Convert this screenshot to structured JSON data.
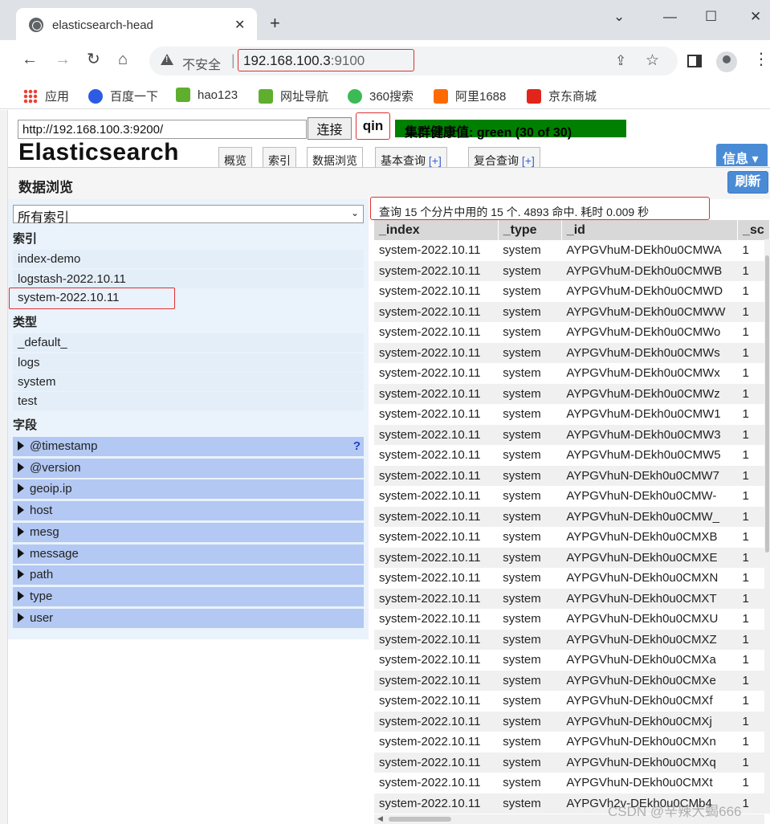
{
  "browser": {
    "tab_title": "elasticsearch-head",
    "new_tab": "+",
    "close_tab": "✕",
    "window_controls": {
      "minimize": "—",
      "maximize": "☐",
      "close": "✕",
      "tabsearch": "⌄"
    },
    "security_label": "不安全",
    "url_host": "192.168.100.3",
    "url_port": ":9100",
    "bookmarks": [
      {
        "label": "应用",
        "color": "#e94235"
      },
      {
        "label": "百度一下",
        "color": "#2d5be3"
      },
      {
        "label": "hao123",
        "color": "#5fae2e"
      },
      {
        "label": "网址导航",
        "color": "#5fae2e"
      },
      {
        "label": "360搜索",
        "color": "#3cba54"
      },
      {
        "label": "阿里1688",
        "color": "#ff6a00"
      },
      {
        "label": "京东商城",
        "color": "#e1251b"
      }
    ]
  },
  "head": {
    "connect_url": "http://192.168.100.3:9200/",
    "connect_label": "连接",
    "cluster_name": "qin",
    "cluster_health": "集群健康值: green (30 of 30)",
    "logo": "Elasticsearch",
    "tabs": [
      {
        "label": "概览",
        "plus": ""
      },
      {
        "label": "索引",
        "plus": ""
      },
      {
        "label": "数据浏览",
        "plus": ""
      },
      {
        "label": "基本查询 ",
        "plus": "[+]"
      },
      {
        "label": "复合查询 ",
        "plus": "[+]"
      }
    ],
    "info_label": "信息 ▾",
    "section_title": "数据浏览",
    "refresh_label": "刷新"
  },
  "filters": {
    "index_select": "所有索引",
    "index_heading": "索引",
    "indices": [
      "index-demo",
      "logstash-2022.10.11",
      "system-2022.10.11"
    ],
    "type_heading": "类型",
    "types": [
      "_default_",
      "logs",
      "system",
      "test"
    ],
    "field_heading": "字段",
    "fields": [
      "@timestamp",
      "@version",
      "geoip.ip",
      "host",
      "mesg",
      "message",
      "path",
      "type",
      "user"
    ],
    "help": "?"
  },
  "results": {
    "summary": "查询 15 个分片中用的 15 个. 4893 命中. 耗时 0.009 秒",
    "columns": [
      "_index",
      "_type",
      "_id",
      "_sc"
    ],
    "rows": [
      [
        "system-2022.10.11",
        "system",
        "AYPGVhuM-DEkh0u0CMWA",
        "1"
      ],
      [
        "system-2022.10.11",
        "system",
        "AYPGVhuM-DEkh0u0CMWB",
        "1"
      ],
      [
        "system-2022.10.11",
        "system",
        "AYPGVhuM-DEkh0u0CMWD",
        "1"
      ],
      [
        "system-2022.10.11",
        "system",
        "AYPGVhuM-DEkh0u0CMWW",
        "1"
      ],
      [
        "system-2022.10.11",
        "system",
        "AYPGVhuM-DEkh0u0CMWo",
        "1"
      ],
      [
        "system-2022.10.11",
        "system",
        "AYPGVhuM-DEkh0u0CMWs",
        "1"
      ],
      [
        "system-2022.10.11",
        "system",
        "AYPGVhuM-DEkh0u0CMWx",
        "1"
      ],
      [
        "system-2022.10.11",
        "system",
        "AYPGVhuM-DEkh0u0CMWz",
        "1"
      ],
      [
        "system-2022.10.11",
        "system",
        "AYPGVhuM-DEkh0u0CMW1",
        "1"
      ],
      [
        "system-2022.10.11",
        "system",
        "AYPGVhuM-DEkh0u0CMW3",
        "1"
      ],
      [
        "system-2022.10.11",
        "system",
        "AYPGVhuM-DEkh0u0CMW5",
        "1"
      ],
      [
        "system-2022.10.11",
        "system",
        "AYPGVhuN-DEkh0u0CMW7",
        "1"
      ],
      [
        "system-2022.10.11",
        "system",
        "AYPGVhuN-DEkh0u0CMW-",
        "1"
      ],
      [
        "system-2022.10.11",
        "system",
        "AYPGVhuN-DEkh0u0CMW_",
        "1"
      ],
      [
        "system-2022.10.11",
        "system",
        "AYPGVhuN-DEkh0u0CMXB",
        "1"
      ],
      [
        "system-2022.10.11",
        "system",
        "AYPGVhuN-DEkh0u0CMXE",
        "1"
      ],
      [
        "system-2022.10.11",
        "system",
        "AYPGVhuN-DEkh0u0CMXN",
        "1"
      ],
      [
        "system-2022.10.11",
        "system",
        "AYPGVhuN-DEkh0u0CMXT",
        "1"
      ],
      [
        "system-2022.10.11",
        "system",
        "AYPGVhuN-DEkh0u0CMXU",
        "1"
      ],
      [
        "system-2022.10.11",
        "system",
        "AYPGVhuN-DEkh0u0CMXZ",
        "1"
      ],
      [
        "system-2022.10.11",
        "system",
        "AYPGVhuN-DEkh0u0CMXa",
        "1"
      ],
      [
        "system-2022.10.11",
        "system",
        "AYPGVhuN-DEkh0u0CMXe",
        "1"
      ],
      [
        "system-2022.10.11",
        "system",
        "AYPGVhuN-DEkh0u0CMXf",
        "1"
      ],
      [
        "system-2022.10.11",
        "system",
        "AYPGVhuN-DEkh0u0CMXj",
        "1"
      ],
      [
        "system-2022.10.11",
        "system",
        "AYPGVhuN-DEkh0u0CMXn",
        "1"
      ],
      [
        "system-2022.10.11",
        "system",
        "AYPGVhuN-DEkh0u0CMXq",
        "1"
      ],
      [
        "system-2022.10.11",
        "system",
        "AYPGVhuN-DEkh0u0CMXt",
        "1"
      ],
      [
        "system-2022.10.11",
        "system",
        "AYPGVh2v-DEkh0u0CMb4",
        "1"
      ]
    ]
  },
  "watermark": "CSDN @辛辣大蝎666",
  "colors": {
    "health": "#008000",
    "accent": "#4a8bd6",
    "highlight": "#e03030",
    "field_bg": "#b3c8f3"
  }
}
